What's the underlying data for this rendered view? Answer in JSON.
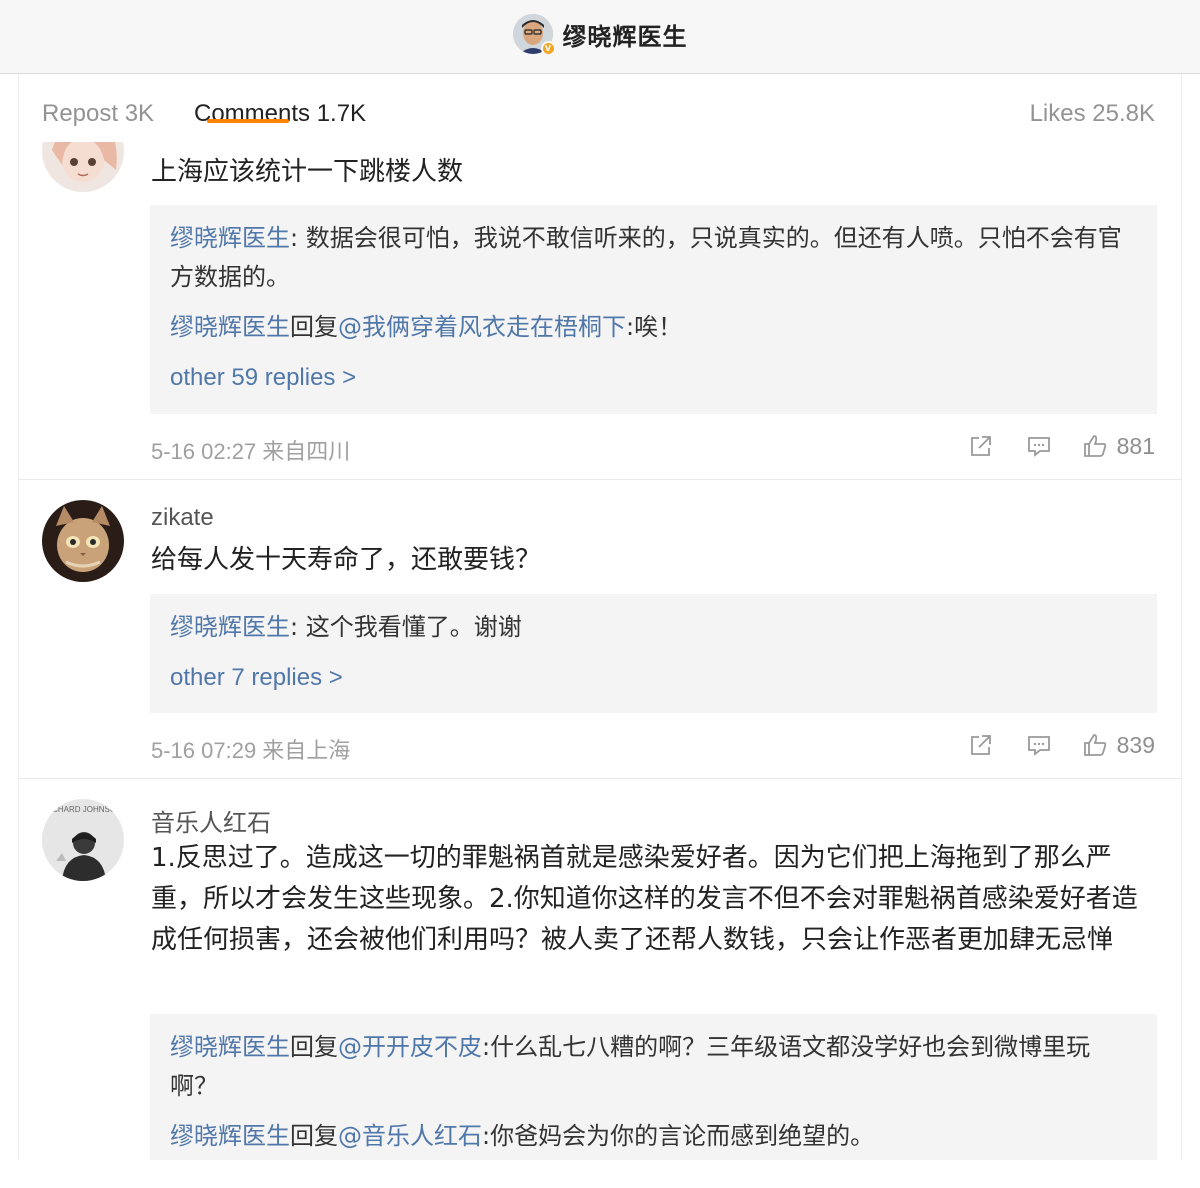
{
  "header": {
    "title": "缪晓辉医生",
    "verified_badge": "V"
  },
  "tabs": {
    "repost": "Repost 3K",
    "comments": "Comments 1.7K",
    "likes": "Likes 25.8K"
  },
  "colors": {
    "accent": "#ff8200",
    "link": "#5077aa",
    "verified": "#f5a623"
  },
  "comments": [
    {
      "username": "",
      "text": "上海应该统计一下跳楼人数",
      "replies": [
        {
          "author": "缪晓辉医生",
          "reply_word": "",
          "mention": "",
          "sep": ": ",
          "text": "数据会很可怕，我说不敢信听来的，只说真实的。但还有人喷。只怕不会有官方数据的。"
        },
        {
          "author": "缪晓辉医生",
          "reply_word": "回复",
          "mention": "@我俩穿着风衣走在梧桐下",
          "sep": ":",
          "text": "唉！"
        }
      ],
      "more": "other 59 replies >",
      "meta": "5-16 02:27 来自四川",
      "likes": "881"
    },
    {
      "username": "zikate",
      "text": "给每人发十天寿命了，还敢要钱？",
      "replies": [
        {
          "author": "缪晓辉医生",
          "reply_word": "",
          "mention": "",
          "sep": ": ",
          "text": "这个我看懂了。谢谢"
        }
      ],
      "more": "other 7 replies >",
      "meta": "5-16 07:29 来自上海",
      "likes": "839"
    },
    {
      "username": "音乐人红石",
      "avatar_text": "RICHARD JOHNSON",
      "text": "1.反思过了。造成这一切的罪魁祸首就是感染爱好者。因为它们把上海拖到了那么严重，所以才会发生这些现象。2.你知道你这样的发言不但不会对罪魁祸首感染爱好者造成任何损害，还会被他们利用吗？被人卖了还帮人数钱，只会让作恶者更加肆无忌惮",
      "replies": [
        {
          "author": "缪晓辉医生",
          "reply_word": "回复",
          "mention": "@开开皮不皮",
          "sep": ":",
          "text": "什么乱七八糟的啊？三年级语文都没学好也会到微博里玩啊？"
        },
        {
          "author": "缪晓辉医生",
          "reply_word": "回复",
          "mention": "@音乐人红石",
          "sep": ":",
          "text": "你爸妈会为你的言论而感到绝望的。"
        }
      ]
    }
  ]
}
